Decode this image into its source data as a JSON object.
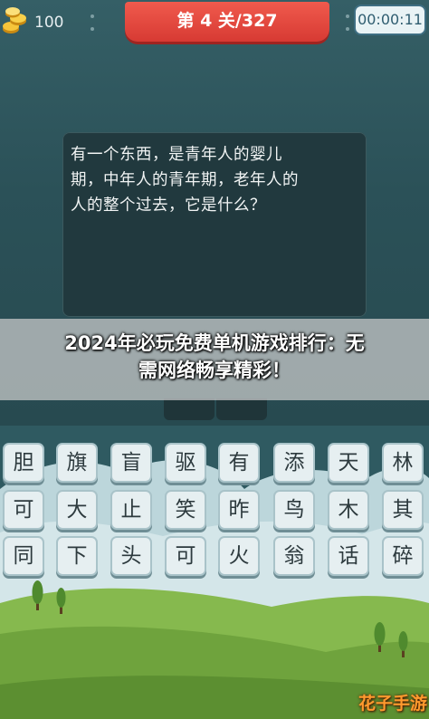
{
  "header": {
    "coins": "100",
    "level_label": "第 4 关/327",
    "timer": "00:00:11"
  },
  "question": {
    "lines": [
      "有一个东西，是青年人的婴儿",
      "期，中年人的青年期，老年人的",
      "人的整个过去，它是什么？"
    ]
  },
  "overlay": {
    "title_line1": "2024年必玩免费单机游戏排行：无",
    "title_line2": "需网络畅享精彩！"
  },
  "tiles": [
    [
      "胆",
      "旗",
      "盲",
      "驱",
      "有",
      "添",
      "天",
      "林"
    ],
    [
      "可",
      "大",
      "止",
      "笑",
      "昨",
      "鸟",
      "木",
      "其"
    ],
    [
      "同",
      "下",
      "头",
      "可",
      "火",
      "翁",
      "话",
      "碎"
    ]
  ],
  "watermark": "花子手游",
  "colors": {
    "banner": "#e5453c",
    "background": "#2d5459",
    "tile": "#e6eff1",
    "grass": "#7fb24a"
  },
  "icons": {
    "coin": "coin-stack-icon"
  }
}
